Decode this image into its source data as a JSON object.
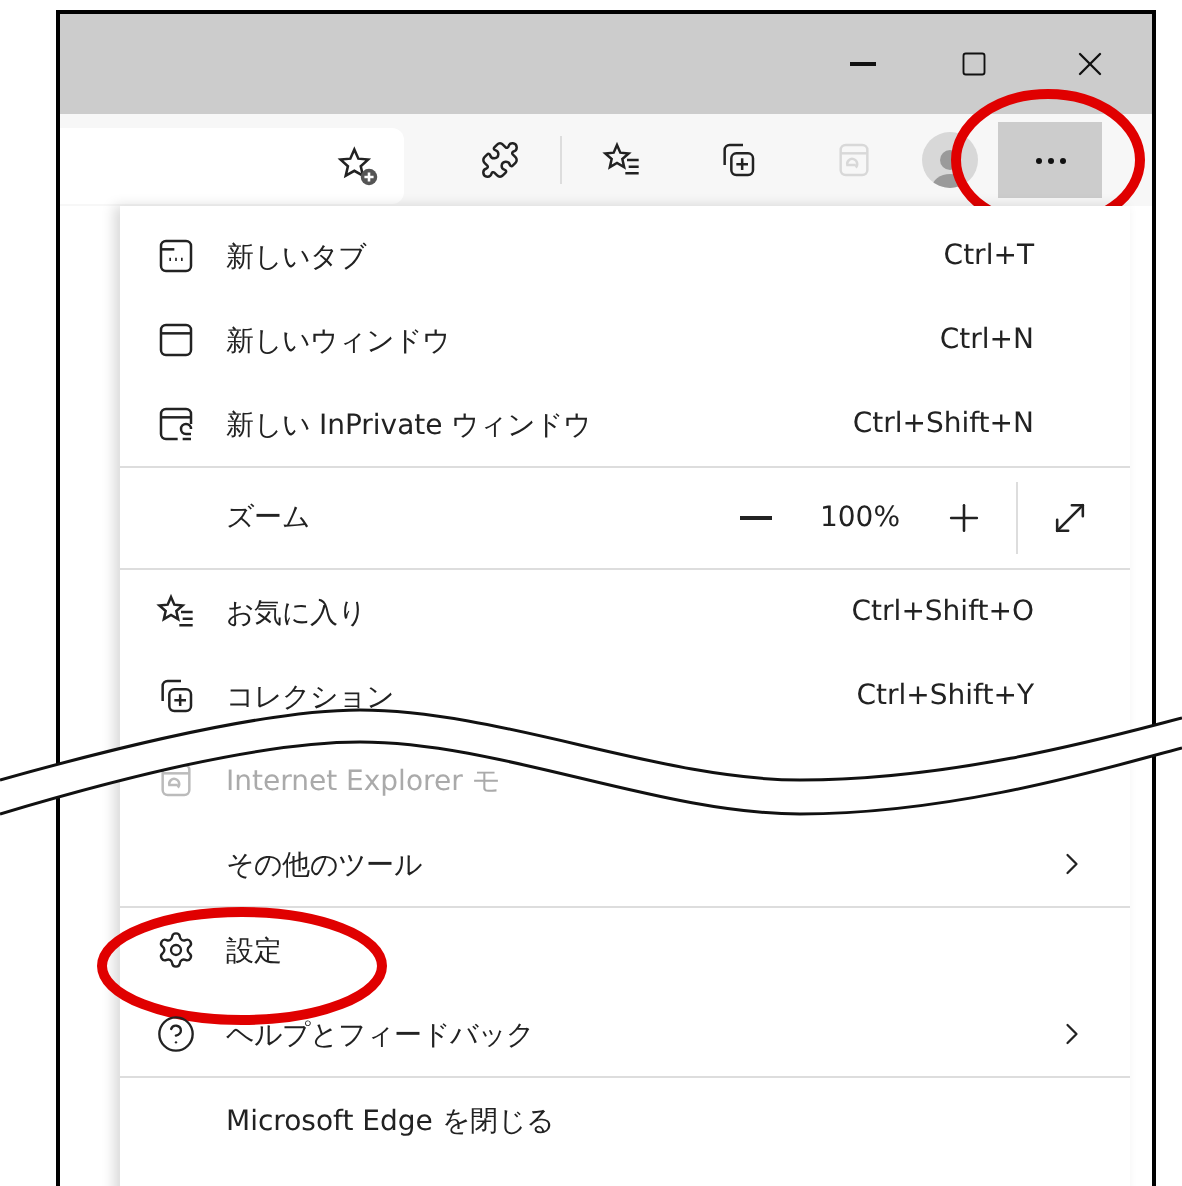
{
  "toolbar": {
    "ie_mode_button": {
      "disabled": true
    },
    "more_button": {
      "pressed": true,
      "highlighted": true
    }
  },
  "menu": {
    "sections": [
      {
        "items": [
          {
            "kind": "item",
            "label": "新しいタブ",
            "shortcut": "Ctrl+T"
          },
          {
            "kind": "item",
            "label": "新しいウィンドウ",
            "shortcut": "Ctrl+N"
          },
          {
            "kind": "item",
            "label": "新しい InPrivate ウィンドウ",
            "shortcut": "Ctrl+Shift+N"
          }
        ]
      },
      {
        "items": [
          {
            "kind": "zoom",
            "label": "ズーム",
            "value": "100%"
          }
        ]
      },
      {
        "items": [
          {
            "kind": "item",
            "label": "お気に入り",
            "shortcut": "Ctrl+Shift+O"
          },
          {
            "kind": "item",
            "label": "コレクション",
            "shortcut": "Ctrl+Shift+Y"
          },
          {
            "kind": "item",
            "label": "Internet Explorer モ",
            "disabled": true
          },
          {
            "kind": "item",
            "label": "その他のツール",
            "submenu": true
          }
        ]
      },
      {
        "items": [
          {
            "kind": "item",
            "label": "設定",
            "highlighted": true
          },
          {
            "kind": "item",
            "label": "ヘルプとフィードバック",
            "submenu": true
          }
        ]
      },
      {
        "items": [
          {
            "kind": "item",
            "label": "Microsoft Edge を閉じる"
          }
        ]
      }
    ]
  }
}
